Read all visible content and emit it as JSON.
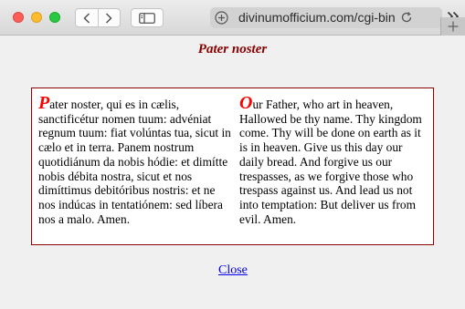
{
  "browser": {
    "url_display": "divinumofficium.com/cgi-bin",
    "icons": {
      "back": "chevron-left-icon",
      "forward": "chevron-right-icon",
      "sidebar": "sidebar-icon",
      "shield": "shield-icon",
      "reload": "reload-icon",
      "overflow": "double-chevron-right-icon",
      "new_tab": "plus-icon"
    },
    "colors": {
      "close_light": "#fc5f57",
      "minimize_light": "#fdbc2e",
      "zoom_light": "#28c840"
    }
  },
  "page": {
    "title": "Pater noster",
    "latin": {
      "initial": "P",
      "text": "ater noster, qui es in cælis, sanctificétur nomen tuum: advéniat regnum tuum: fiat volúntas tua, sicut in cælo et in terra. Panem nostrum quotidiánum da nobis hódie: et dimítte nobis débita nostra, sicut et nos dimíttimus debitóribus nostris: et ne nos indúcas in tentatiónem: sed líbera nos a malo. Amen."
    },
    "english": {
      "initial": "O",
      "text": "ur Father, who art in heaven, Hallowed be thy name. Thy kingdom come. Thy will be done on earth as it is in heaven. Give us this day our daily bread. And forgive us our trespasses, as we forgive those who trespass against us. And lead us not into temptation: But deliver us from evil. Amen."
    },
    "close_label": "Close",
    "colors": {
      "title": "#8b0000",
      "initial": "#ff0000",
      "border": "#8b0000",
      "link": "#0000ee"
    }
  }
}
